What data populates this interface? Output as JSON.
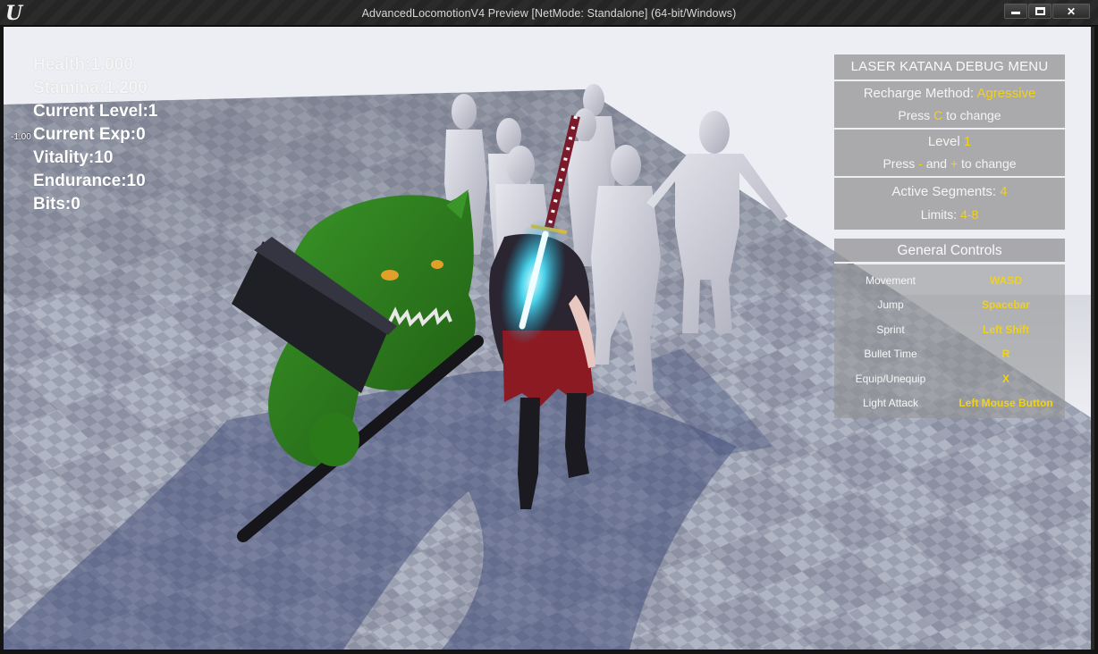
{
  "window": {
    "title": "AdvancedLocomotionV4 Preview [NetMode: Standalone]  (64-bit/Windows)",
    "logo_icon": "unreal-engine-logo",
    "controls": [
      "minimize",
      "maximize",
      "close"
    ],
    "close_glyph": "✕"
  },
  "hud": {
    "stats": [
      "Health:1.000",
      "Stamina:1.200",
      "Current Level:1",
      "Current Exp:0",
      "Vitality:10",
      "Endurance:10",
      "Bits:0"
    ],
    "debug_float": "-1.00"
  },
  "debug_menu": {
    "title": "LASER KATANA DEBUG MENU",
    "recharge": {
      "label": "Recharge Method: ",
      "value": "Agressive",
      "hint_prefix": "Press ",
      "hint_key": "C",
      "hint_suffix": " to change"
    },
    "level": {
      "label": "Level ",
      "value": "1",
      "hint_prefix": "Press ",
      "hint_key1": "-",
      "hint_mid": " and ",
      "hint_key2": "+",
      "hint_suffix": " to change"
    },
    "segments": {
      "label": "Active Segments: ",
      "value": "4",
      "limits_label": "Limits: ",
      "limits_value": "4-8"
    }
  },
  "general_controls": {
    "title": "General Controls",
    "rows": [
      {
        "action": "Movement",
        "key": "WASD"
      },
      {
        "action": "Jump",
        "key": "Spacebar"
      },
      {
        "action": "Sprint",
        "key": "Left Shift"
      },
      {
        "action": "Bullet Time",
        "key": "R"
      },
      {
        "action": "Equip/Unequip",
        "key": "X"
      },
      {
        "action": "Light Attack",
        "key": "Left Mouse Button"
      }
    ]
  },
  "colors": {
    "accent_yellow": "#f0d21a",
    "katana_glow": "#4fe6ff",
    "ogre_green": "#2f7d1c"
  }
}
